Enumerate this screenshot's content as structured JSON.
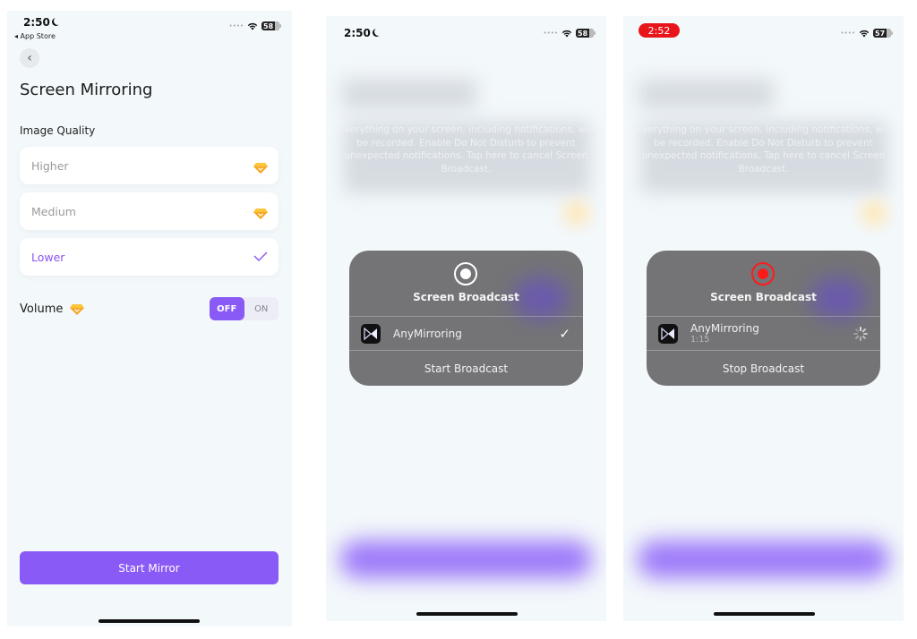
{
  "screen1": {
    "status": {
      "time": "2:50",
      "battery": "58",
      "back_app": "◂ App Store"
    },
    "back_icon": "‹",
    "title": "Screen Mirroring",
    "image_quality_label": "Image Quality",
    "options": [
      {
        "label": "Higher",
        "badge": "premium-gem"
      },
      {
        "label": "Medium",
        "badge": "premium-gem"
      },
      {
        "label": "Lower",
        "badge": "checkmark",
        "selected": true
      }
    ],
    "check_glyph": "✓",
    "volume": {
      "label": "Volume",
      "off_label": "OFF",
      "on_label": "ON",
      "state": "OFF"
    },
    "start_button": "Start Mirror"
  },
  "screen2": {
    "status": {
      "time": "2:50",
      "battery": "58"
    },
    "notice": "Everything on your screen, including notifications, will be recorded. Enable Do Not Disturb to prevent unexpected notifications. Tap here to cancel Screen Broadcast.",
    "sheet": {
      "title": "Screen Broadcast",
      "app_name": "AnyMirroring",
      "check_glyph": "✓",
      "action": "Start Broadcast"
    }
  },
  "screen3": {
    "status": {
      "time": "2:52",
      "battery": "57"
    },
    "notice": "Everything on your screen, including notifications, will be recorded. Enable Do Not Disturb to prevent unexpected notifications. Tap here to cancel Screen Broadcast.",
    "sheet": {
      "title": "Screen Broadcast",
      "app_name": "AnyMirroring",
      "elapsed": "1:15",
      "action": "Stop Broadcast"
    }
  },
  "colors": {
    "accent": "#8a5af6",
    "recording": "#e8161b",
    "gem": "#f5a623"
  }
}
